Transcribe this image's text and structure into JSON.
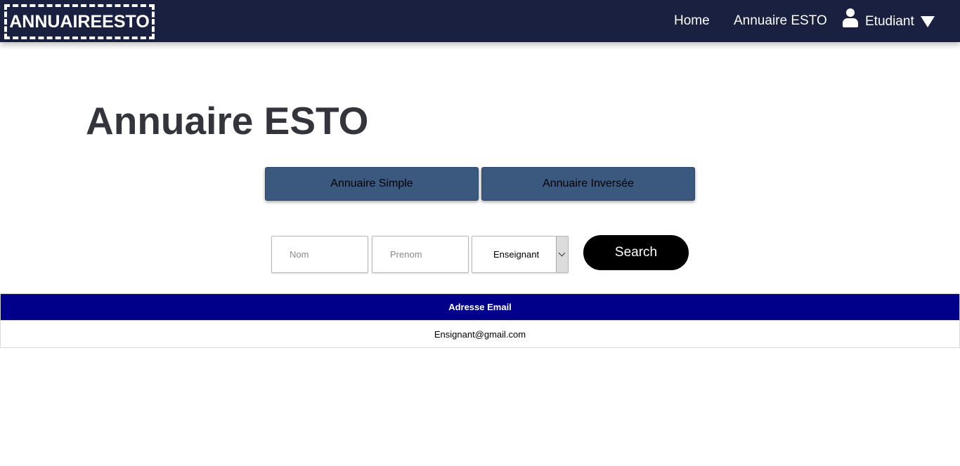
{
  "navbar": {
    "logo": "ANNUAIREESTO",
    "links": [
      {
        "label": "Home"
      },
      {
        "label": "Annuaire ESTO"
      }
    ],
    "user": {
      "label": "Etudiant",
      "icon": "user-icon",
      "dropdown_icon": "caret-down-icon"
    },
    "background": "#1a2040"
  },
  "page": {
    "title": "Annuaire ESTO"
  },
  "tabs": [
    {
      "label": "Annuaire Simple"
    },
    {
      "label": "Annuaire Inversée"
    }
  ],
  "search": {
    "nom": {
      "value": "",
      "placeholder": "Nom"
    },
    "prenom": {
      "value": "",
      "placeholder": "Prenom"
    },
    "type_select": {
      "selected": "Enseignant"
    },
    "button_label": "Search"
  },
  "table": {
    "header_color": "#00008b",
    "columns": [
      "Adresse Email"
    ],
    "rows": [
      [
        "Ensignant@gmail.com"
      ]
    ]
  },
  "colors": {
    "tab_button": "#3b587e",
    "search_button": "#000000",
    "title": "#33343c"
  }
}
